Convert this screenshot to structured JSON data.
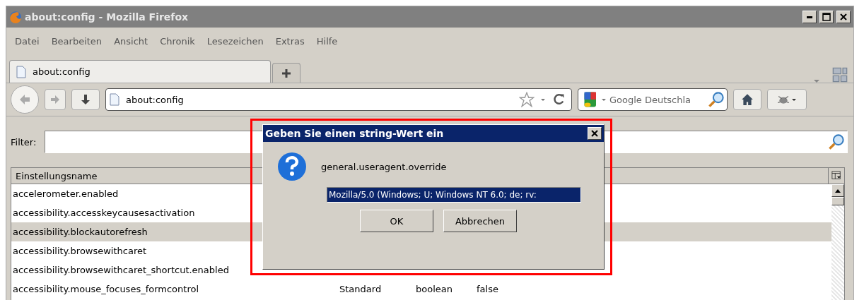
{
  "window": {
    "title": "about:config - Mozilla Firefox"
  },
  "menu": [
    "Datei",
    "Bearbeiten",
    "Ansicht",
    "Chronik",
    "Lesezeichen",
    "Extras",
    "Hilfe"
  ],
  "tabs": [
    {
      "label": "about:config",
      "selected": true
    }
  ],
  "address": {
    "value": "about:config"
  },
  "search": {
    "placeholder": "Google Deutschla"
  },
  "filter": {
    "label": "Filter:"
  },
  "table": {
    "columns": [
      "Einstellungsname"
    ],
    "rows": [
      {
        "cells": [
          "accelerometer.enabled"
        ],
        "selected": false
      },
      {
        "cells": [
          "accessibility.accesskeycausesactivation"
        ],
        "selected": false
      },
      {
        "cells": [
          "accessibility.blockautorefresh"
        ],
        "selected": true
      },
      {
        "cells": [
          "accessibility.browsewithcaret"
        ],
        "selected": false
      },
      {
        "cells": [
          "accessibility.browsewithcaret_shortcut.enabled"
        ],
        "selected": false
      },
      {
        "cells": [
          "accessibility.mouse_focuses_formcontrol",
          "Standard",
          "boolean",
          "false"
        ],
        "selected": false
      }
    ]
  },
  "dialog": {
    "title": "Geben Sie einen string-Wert ein",
    "message": "general.useragent.override",
    "value": "Mozilla/5.0 (Windows; U; Windows NT 6.0; de; rv:",
    "buttons": [
      "OK",
      "Abbrechen"
    ]
  }
}
